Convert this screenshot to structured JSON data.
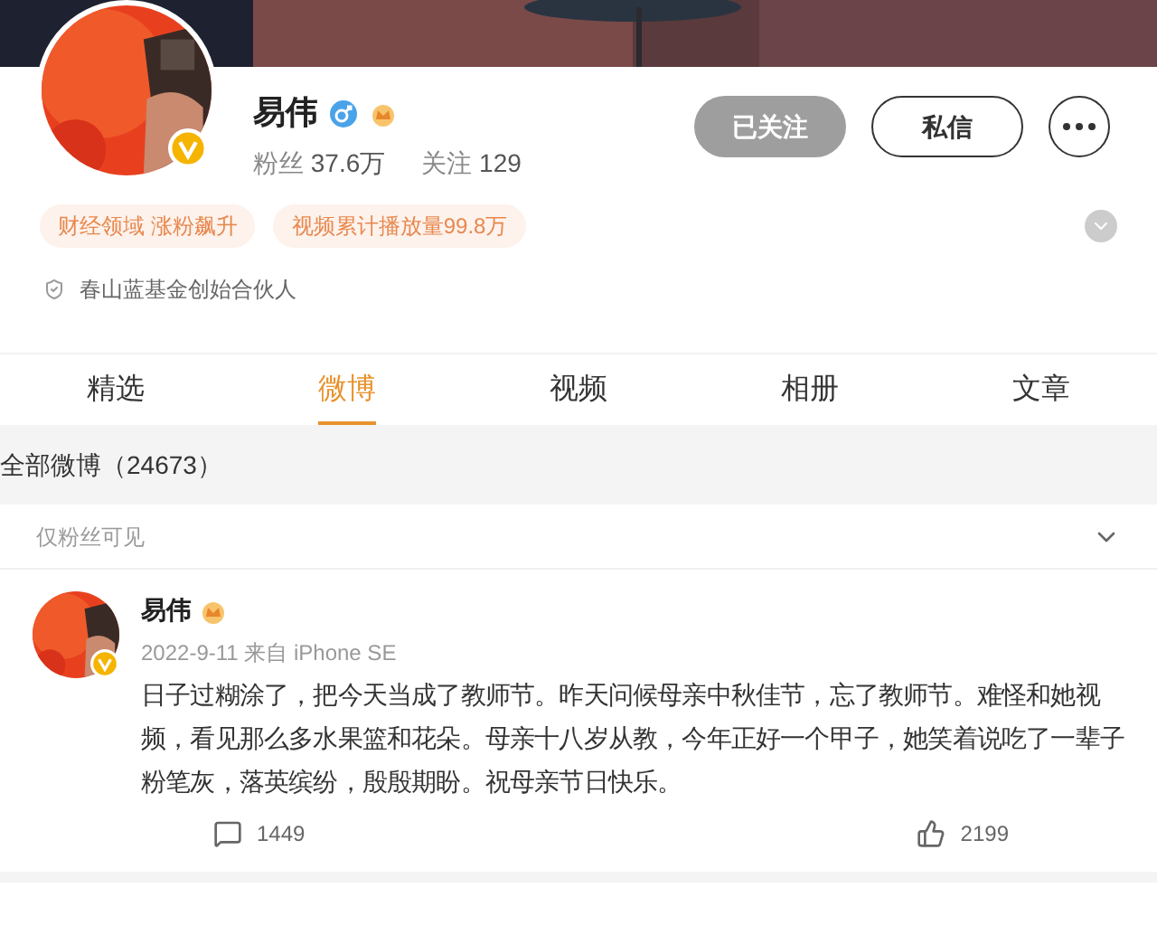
{
  "profile": {
    "name": "易伟",
    "verified": true,
    "stats": [
      {
        "label": "粉丝",
        "value": "37.6万"
      },
      {
        "label": "关注",
        "value": "129"
      }
    ],
    "buttons": [
      {
        "label": "已关注",
        "kind": "followed"
      },
      {
        "label": "私信",
        "kind": "outline"
      }
    ],
    "tags": [
      "财经领域 涨粉飙升",
      "视频累计播放量99.8万"
    ],
    "description": "春山蓝基金创始合伙人"
  },
  "tabs": [
    {
      "label": "精选",
      "selected": false
    },
    {
      "label": "微博",
      "selected": true
    },
    {
      "label": "视频",
      "selected": false
    },
    {
      "label": "相册",
      "selected": false
    },
    {
      "label": "文章",
      "selected": false
    }
  ],
  "feed_header": "全部微博（24673）",
  "filter": {
    "label": "仅粉丝可见"
  },
  "post": {
    "author": "易伟",
    "verified": true,
    "meta": "2022-9-11 来自 iPhone SE",
    "text": "日子过糊涂了，把今天当成了教师节。昨天问候母亲中秋佳节，忘了教师节。难怪和她视频，看见那么多水果篮和花朵。母亲十八岁从教，今年正好一个甲子，她笑着说吃了一辈子粉笔灰，落英缤纷，殷殷期盼。祝母亲节日快乐。",
    "comments": "1449",
    "likes": "2199"
  }
}
